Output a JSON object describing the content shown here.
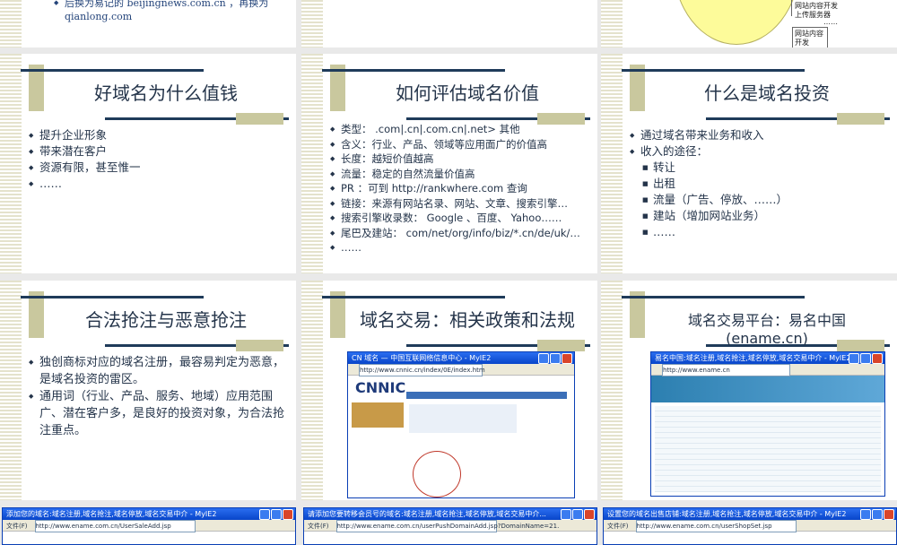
{
  "slides": {
    "s0": {
      "bullet": "后换为易记的 beijingnews.com.cn ，再换为 qianlong.com"
    },
    "s2": {
      "diagram": [
        "网站内容开发",
        "上传服务器",
        "……",
        "网站内容开发"
      ]
    },
    "s3": {
      "title": "好域名为什么值钱",
      "bullets": [
        "提升企业形象",
        "带来潜在客户",
        "资源有限，甚至惟一",
        "……"
      ]
    },
    "s4": {
      "title": "如何评估域名价值",
      "bullets": [
        "类型： .com|.cn|.com.cn|.net> 其他",
        "含义：行业、产品、领域等应用面广的价值高",
        "长度：越短价值越高",
        "流量：稳定的自然流量价值高",
        "PR ：可到 http://rankwhere.com 查询",
        "链接：来源有网站名录、网站、文章、搜索引擎…",
        "搜索引擎收录数： Google 、百度、 Yahoo……",
        "尾巴及建站： com/net/org/info/biz/*.cn/de/uk/…",
        "……"
      ]
    },
    "s5": {
      "title": "什么是域名投资",
      "bullets": [
        "通过域名带来业务和收入",
        "收入的途径："
      ],
      "sub": [
        "转让",
        "出租",
        "流量（广告、停放、……）",
        "建站（增加网站业务）",
        "……"
      ]
    },
    "s6": {
      "title": "合法抢注与恶意抢注",
      "bullets": [
        "独创商标对应的域名注册，最容易判定为恶意，是域名投资的雷区。",
        "通用词（行业、产品、服务、地域）应用范围广、潜在客户多，是良好的投资对象，为合法抢注重点。"
      ]
    },
    "s7": {
      "title": "域名交易：相关政策和法规",
      "win_title": "CN 域名 — 中国互联网络信息中心 - MyIE2",
      "logo": "CNNIC",
      "url": "http://www.cnnic.cn/index/0E/index.htm"
    },
    "s8": {
      "title": "域名交易平台：易名中国 (ename.cn)",
      "win_title": "易名中国:域名注册,域名抢注,域名停放,域名交易中介 - MyIE2",
      "url": "http://www.ename.cn"
    }
  },
  "windows": [
    {
      "title": "添加您的域名:域名注册,域名抢注,域名停放,域名交易中介 - MyIE2",
      "menu": "文件(F)",
      "url": "http://www.ename.com.cn/UserSaleAdd.jsp"
    },
    {
      "title": "请添加您要转移会员号的域名:域名注册,域名抢注,域名停放,域名交易中介...",
      "menu": "文件(F)",
      "url": "http://www.ename.com.cn/userPushDomainAdd.jsp?DomainName=21."
    },
    {
      "title": "设置您的域名出售店铺:域名注册,域名抢注,域名停放,域名交易中介 - MyIE2",
      "menu": "文件(F)",
      "url": "http://www.ename.com.cn/userShopSet.jsp"
    }
  ]
}
